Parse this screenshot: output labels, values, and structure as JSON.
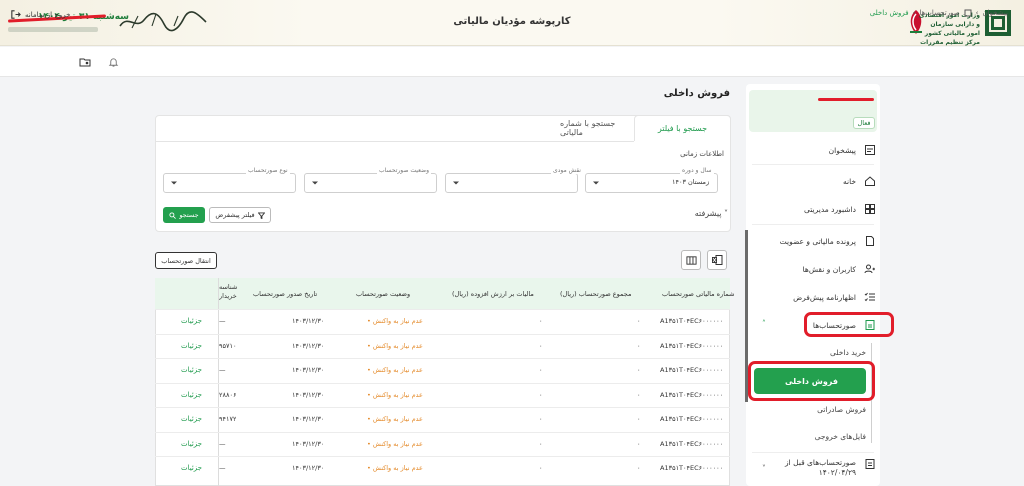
{
  "header": {
    "date": "سه‌شنبه ۳۱ تیر ۱۴۰۴",
    "app_title": "کارپوشه مؤدیان مالیاتی",
    "org_text": "وزارت امور اقتصادی و دارایی سازمان امور مالیاتی کشور مرکز تنظیم مقررات"
  },
  "toolbar": {
    "logout_label": "خروج از سامانه",
    "breadcrumb": [
      "پیشخوان",
      "صورتحساب‌ها",
      "فروش داخلی"
    ]
  },
  "sidebar": {
    "user_status": "فعال",
    "items": [
      {
        "label": "پیشخوان",
        "icon": "dashboard-icon"
      },
      {
        "label": "خانه",
        "icon": "home-icon"
      },
      {
        "label": "داشبورد مدیریتی",
        "icon": "grid-icon"
      },
      {
        "label": "پرونده مالیاتی و عضویت",
        "icon": "file-icon"
      },
      {
        "label": "کاربران و نقش‌ها",
        "icon": "users-icon"
      },
      {
        "label": "اظهارنامه پیش‌فرض",
        "icon": "list-check-icon"
      },
      {
        "label": "صورتحساب‌ها",
        "icon": "receipt-icon"
      }
    ],
    "subitems": [
      "خرید داخلی",
      "فروش داخلی",
      "فروش صادراتی",
      "فایل‌های خروجی"
    ],
    "last_item": {
      "label": "صورتحساب‌های قبل از",
      "sub": "۱۴۰۲/۰۴/۲۹"
    }
  },
  "main": {
    "page_title": "فروش داخلی",
    "tabs": [
      "جستجو با فیلتر",
      "جستجو با شماره مالیاتی"
    ],
    "time_info": "اطلاعات زمانی",
    "fields": [
      {
        "label": "سال و دوره",
        "value": "زمستان ۱۴۰۳"
      },
      {
        "label": "نقش مودی",
        "value": ""
      },
      {
        "label": "وضعیت صورتحساب",
        "value": ""
      },
      {
        "label": "نوع صورتحساب",
        "value": ""
      }
    ],
    "search_label": "جستجو",
    "default_filter_label": "فیلتر پیشفرض",
    "advanced_label": "پیشرفته",
    "transfer_label": "انتقال صورتحساب"
  },
  "table": {
    "headers": [
      "شماره مالیاتی صورتحساب",
      "مجموع صورتحساب (ریال)",
      "مالیات بر ارزش افزوده (ریال)",
      "وضعیت صورتحساب",
      "تاریخ صدور صورتحساب",
      "شناسه خریدار"
    ],
    "rows": [
      {
        "tax_id": "A1۳۵۱T۰۴EC۶۰۰۰۰۰۰",
        "total": "۰",
        "vat": "۰",
        "status": "عدم نیاز به واکنش",
        "date": "۱۴۰۳/۱۲/۳۰",
        "buyer": "—",
        "action": "جزئیات"
      },
      {
        "tax_id": "A1۳۵۱T۰۴EC۶۰۰۰۰۰۰",
        "total": "۰",
        "vat": "۰",
        "status": "عدم نیاز به واکنش",
        "date": "۱۴۰۳/۱۲/۳۰",
        "buyer": "۹۵۷۱۰",
        "action": "جزئیات"
      },
      {
        "tax_id": "A1۳۵۱T۰۴EC۶۰۰۰۰۰۰",
        "total": "۰",
        "vat": "۰",
        "status": "عدم نیاز به واکنش",
        "date": "۱۴۰۳/۱۲/۳۰",
        "buyer": "—",
        "action": "جزئیات"
      },
      {
        "tax_id": "A1۳۵۱T۰۴EC۶۰۰۰۰۰۰",
        "total": "۰",
        "vat": "۰",
        "status": "عدم نیاز به واکنش",
        "date": "۱۴۰۳/۱۲/۳۰",
        "buyer": "۲۸۸۰۶",
        "action": "جزئیات"
      },
      {
        "tax_id": "A1۳۵۱T۰۴EC۶۰۰۰۰۰۰",
        "total": "۰",
        "vat": "۰",
        "status": "عدم نیاز به واکنش",
        "date": "۱۴۰۳/۱۲/۳۰",
        "buyer": "۹۴۱۷۲",
        "action": "جزئیات"
      },
      {
        "tax_id": "A1۳۵۱T۰۴EC۶۰۰۰۰۰۰",
        "total": "۰",
        "vat": "۰",
        "status": "عدم نیاز به واکنش",
        "date": "۱۴۰۳/۱۲/۳۰",
        "buyer": "—",
        "action": "جزئیات"
      },
      {
        "tax_id": "A1۳۵۱T۰۴EC۶۰۰۰۰۰۰",
        "total": "۰",
        "vat": "۰",
        "status": "عدم نیاز به واکنش",
        "date": "۱۴۰۳/۱۲/۳۰",
        "buyer": "—",
        "action": "جزئیات"
      }
    ]
  },
  "colors": {
    "accent": "#23a04e",
    "annotation": "#e11d2a",
    "status": "#e48a2a"
  }
}
